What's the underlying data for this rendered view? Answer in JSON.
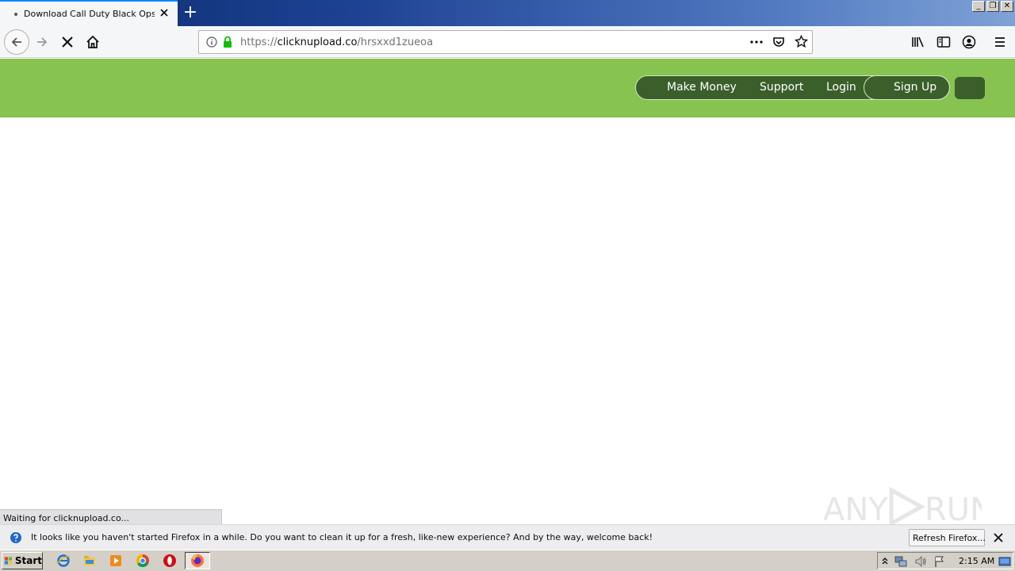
{
  "browser": {
    "tab": {
      "title": "Download Call Duty Black Ops III U"
    },
    "new_tab_label": "+",
    "window_buttons": [
      "_",
      "❐",
      "✕"
    ],
    "url": {
      "prefix": "https://",
      "host": "clicknupload.co",
      "path": "/hrsxxd1zueoa"
    },
    "status_text": "Waiting for clicknupload.co..."
  },
  "site": {
    "nav": {
      "make_money": "Make Money",
      "support": "Support",
      "login": "Login",
      "signup": "Sign Up"
    },
    "colors": {
      "header": "#86c350",
      "pill": "#3b5f2b"
    }
  },
  "notification": {
    "message": "It looks like you haven't started Firefox in a while. Do you want to clean it up for a fresh, like-new experience? And by the way, welcome back!",
    "button_label": "Refresh Firefox..."
  },
  "watermark": {
    "text": "ANY RUN"
  },
  "taskbar": {
    "start_label": "Start",
    "apps": [
      "internet-explorer-icon",
      "file-explorer-icon",
      "media-player-icon",
      "chrome-icon",
      "opera-icon",
      "firefox-icon"
    ],
    "clock": "2:15 AM"
  }
}
